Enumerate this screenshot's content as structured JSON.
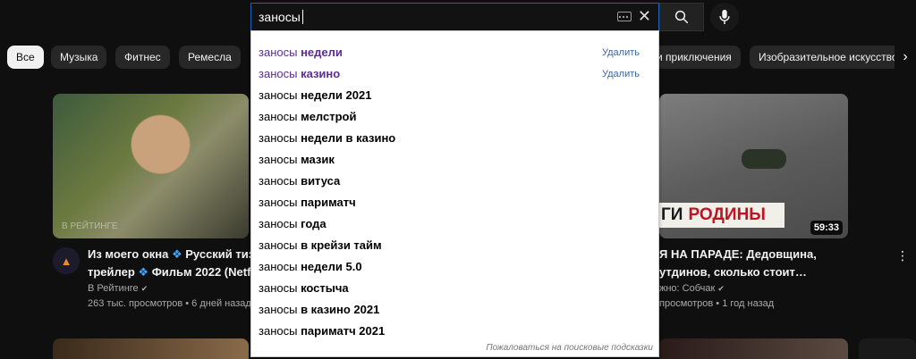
{
  "search": {
    "query": "заносы",
    "clear_icon": "close-icon",
    "keyboard_icon": "keyboard-icon"
  },
  "chips": [
    "Все",
    "Музыка",
    "Фитнес",
    "Ремесла",
    "и приключения",
    "Изобразительное искусство"
  ],
  "suggestions": [
    {
      "prefix": "заносы",
      "rest": "недели",
      "history": true
    },
    {
      "prefix": "заносы",
      "rest": "казино",
      "history": true
    },
    {
      "prefix": "заносы",
      "rest": "недели 2021",
      "history": false
    },
    {
      "prefix": "заносы",
      "rest": "мелстрой",
      "history": false
    },
    {
      "prefix": "заносы",
      "rest": "недели в казино",
      "history": false
    },
    {
      "prefix": "заносы",
      "rest": "мазик",
      "history": false
    },
    {
      "prefix": "заносы",
      "rest": "витуса",
      "history": false
    },
    {
      "prefix": "заносы",
      "rest": "париматч",
      "history": false
    },
    {
      "prefix": "заносы",
      "rest": "года",
      "history": false
    },
    {
      "prefix": "заносы",
      "rest": "в крейзи тайм",
      "history": false
    },
    {
      "prefix": "заносы",
      "rest": "недели 5.0",
      "history": false
    },
    {
      "prefix": "заносы",
      "rest": "костыча",
      "history": false
    },
    {
      "prefix": "заносы",
      "rest": "в казино 2021",
      "history": false
    },
    {
      "prefix": "заносы",
      "rest": "париматч 2021",
      "history": false
    }
  ],
  "delete_label": "Удалить",
  "report_label": "Пожаловаться на поисковые подсказки",
  "video_left": {
    "title_line1": "Из моего окна",
    "title_part2": "Русский тиз",
    "title_line2a": "трейлер",
    "title_line2b": "Фильм 2022 (Netfl",
    "channel": "В Рейтинге",
    "stats": "263 тыс. просмотров • 6 дней назад",
    "watermark": "В РЕЙТИНГЕ"
  },
  "video_right": {
    "title_line1": "Я НА ПАРАДЕ: Дедовщина,",
    "title_line2": "утдинов, сколько стоит…",
    "channel": "жно: Собчак",
    "stats": "просмотров • 1 год назад",
    "duration": "59:33",
    "banner_text_a": "ГИ",
    "banner_text_b": "РОДИНЫ"
  },
  "colors": {
    "accent": "#1c62b9",
    "history_link": "#5c2d91",
    "verified": "#3ea6ff"
  }
}
